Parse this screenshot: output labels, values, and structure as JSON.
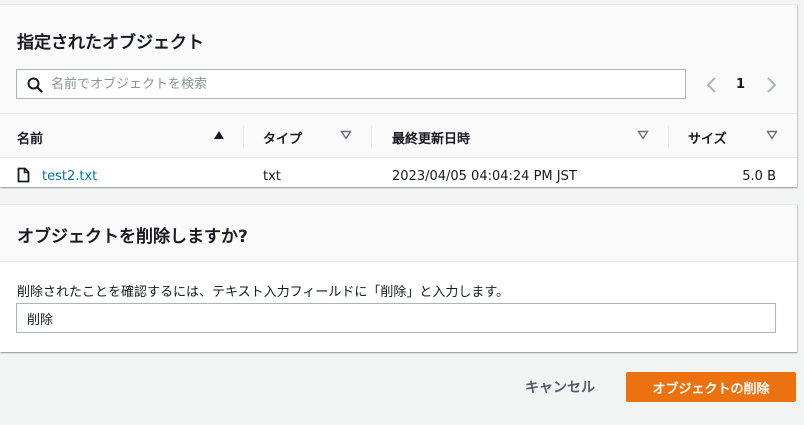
{
  "objects_panel": {
    "title": "指定されたオブジェクト",
    "search": {
      "placeholder": "名前でオブジェクトを検索",
      "value": ""
    },
    "pagination": {
      "current_page": "1"
    },
    "columns": [
      {
        "label": "名前",
        "sort_icon": "sort-ascending-icon"
      },
      {
        "label": "タイプ",
        "sort_icon": "sort-descending-icon"
      },
      {
        "label": "最終更新日時",
        "sort_icon": "sort-descending-icon"
      },
      {
        "label": "サイズ",
        "sort_icon": "sort-descending-icon"
      }
    ],
    "rows": [
      {
        "name": "test2.txt",
        "type": "txt",
        "last_modified": "2023/04/05 04:04:24 PM JST",
        "size": "5.0 B",
        "icon": "file-icon"
      }
    ]
  },
  "confirm_panel": {
    "title": "オブジェクトを削除しますか?",
    "instruction": "削除されたことを確認するには、テキスト入力フィールドに「削除」と入力します。",
    "input_value": "削除"
  },
  "footer": {
    "cancel_label": "キャンセル",
    "delete_label": "オブジェクトの削除"
  },
  "colors": {
    "link": "#0073bb",
    "primary_button": "#ec7211",
    "background": "#f2f3f3"
  }
}
